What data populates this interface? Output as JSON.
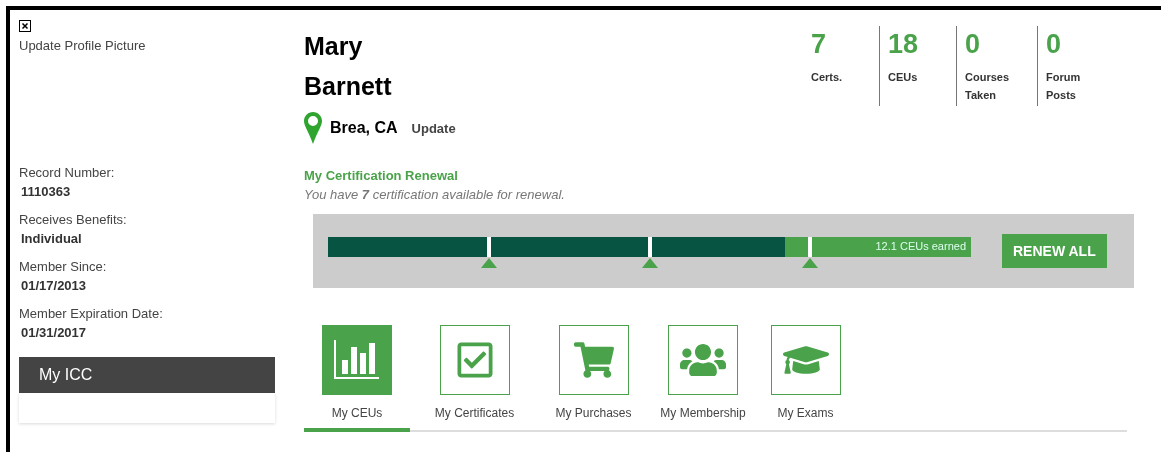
{
  "profile": {
    "picture_link": "Update Profile Picture",
    "first_name": "Mary",
    "last_name": "Barnett",
    "location": "Brea, CA",
    "location_link": "Update"
  },
  "details": [
    {
      "label": "Record Number:",
      "value": "1110363"
    },
    {
      "label": "Receives Benefits:",
      "value": "Individual"
    },
    {
      "label": "Member Since:",
      "value": "01/17/2013"
    },
    {
      "label": "Member Expiration Date:",
      "value": "01/31/2017"
    }
  ],
  "sidebar_menu": {
    "title": "My ICC"
  },
  "stats": [
    {
      "value": "7",
      "label": "Certs."
    },
    {
      "value": "18",
      "label": "CEUs"
    },
    {
      "value": "0",
      "label": "Courses Taken"
    },
    {
      "value": "0",
      "label": "Forum Posts"
    }
  ],
  "renewal": {
    "title": "My Certification Renewal",
    "message": "You have **7** certification available for renewal.",
    "level": 0.71,
    "reading": "12.1 CEUs earned",
    "button": "RENEW ALL"
  },
  "tabs": [
    {
      "label": "My CEUs",
      "selected": true
    },
    {
      "label": "My Certificates",
      "selected": false
    },
    {
      "label": "My Purchases",
      "selected": false
    },
    {
      "label": "My Membership",
      "selected": false
    },
    {
      "label": "My Exams",
      "selected": false
    }
  ]
}
